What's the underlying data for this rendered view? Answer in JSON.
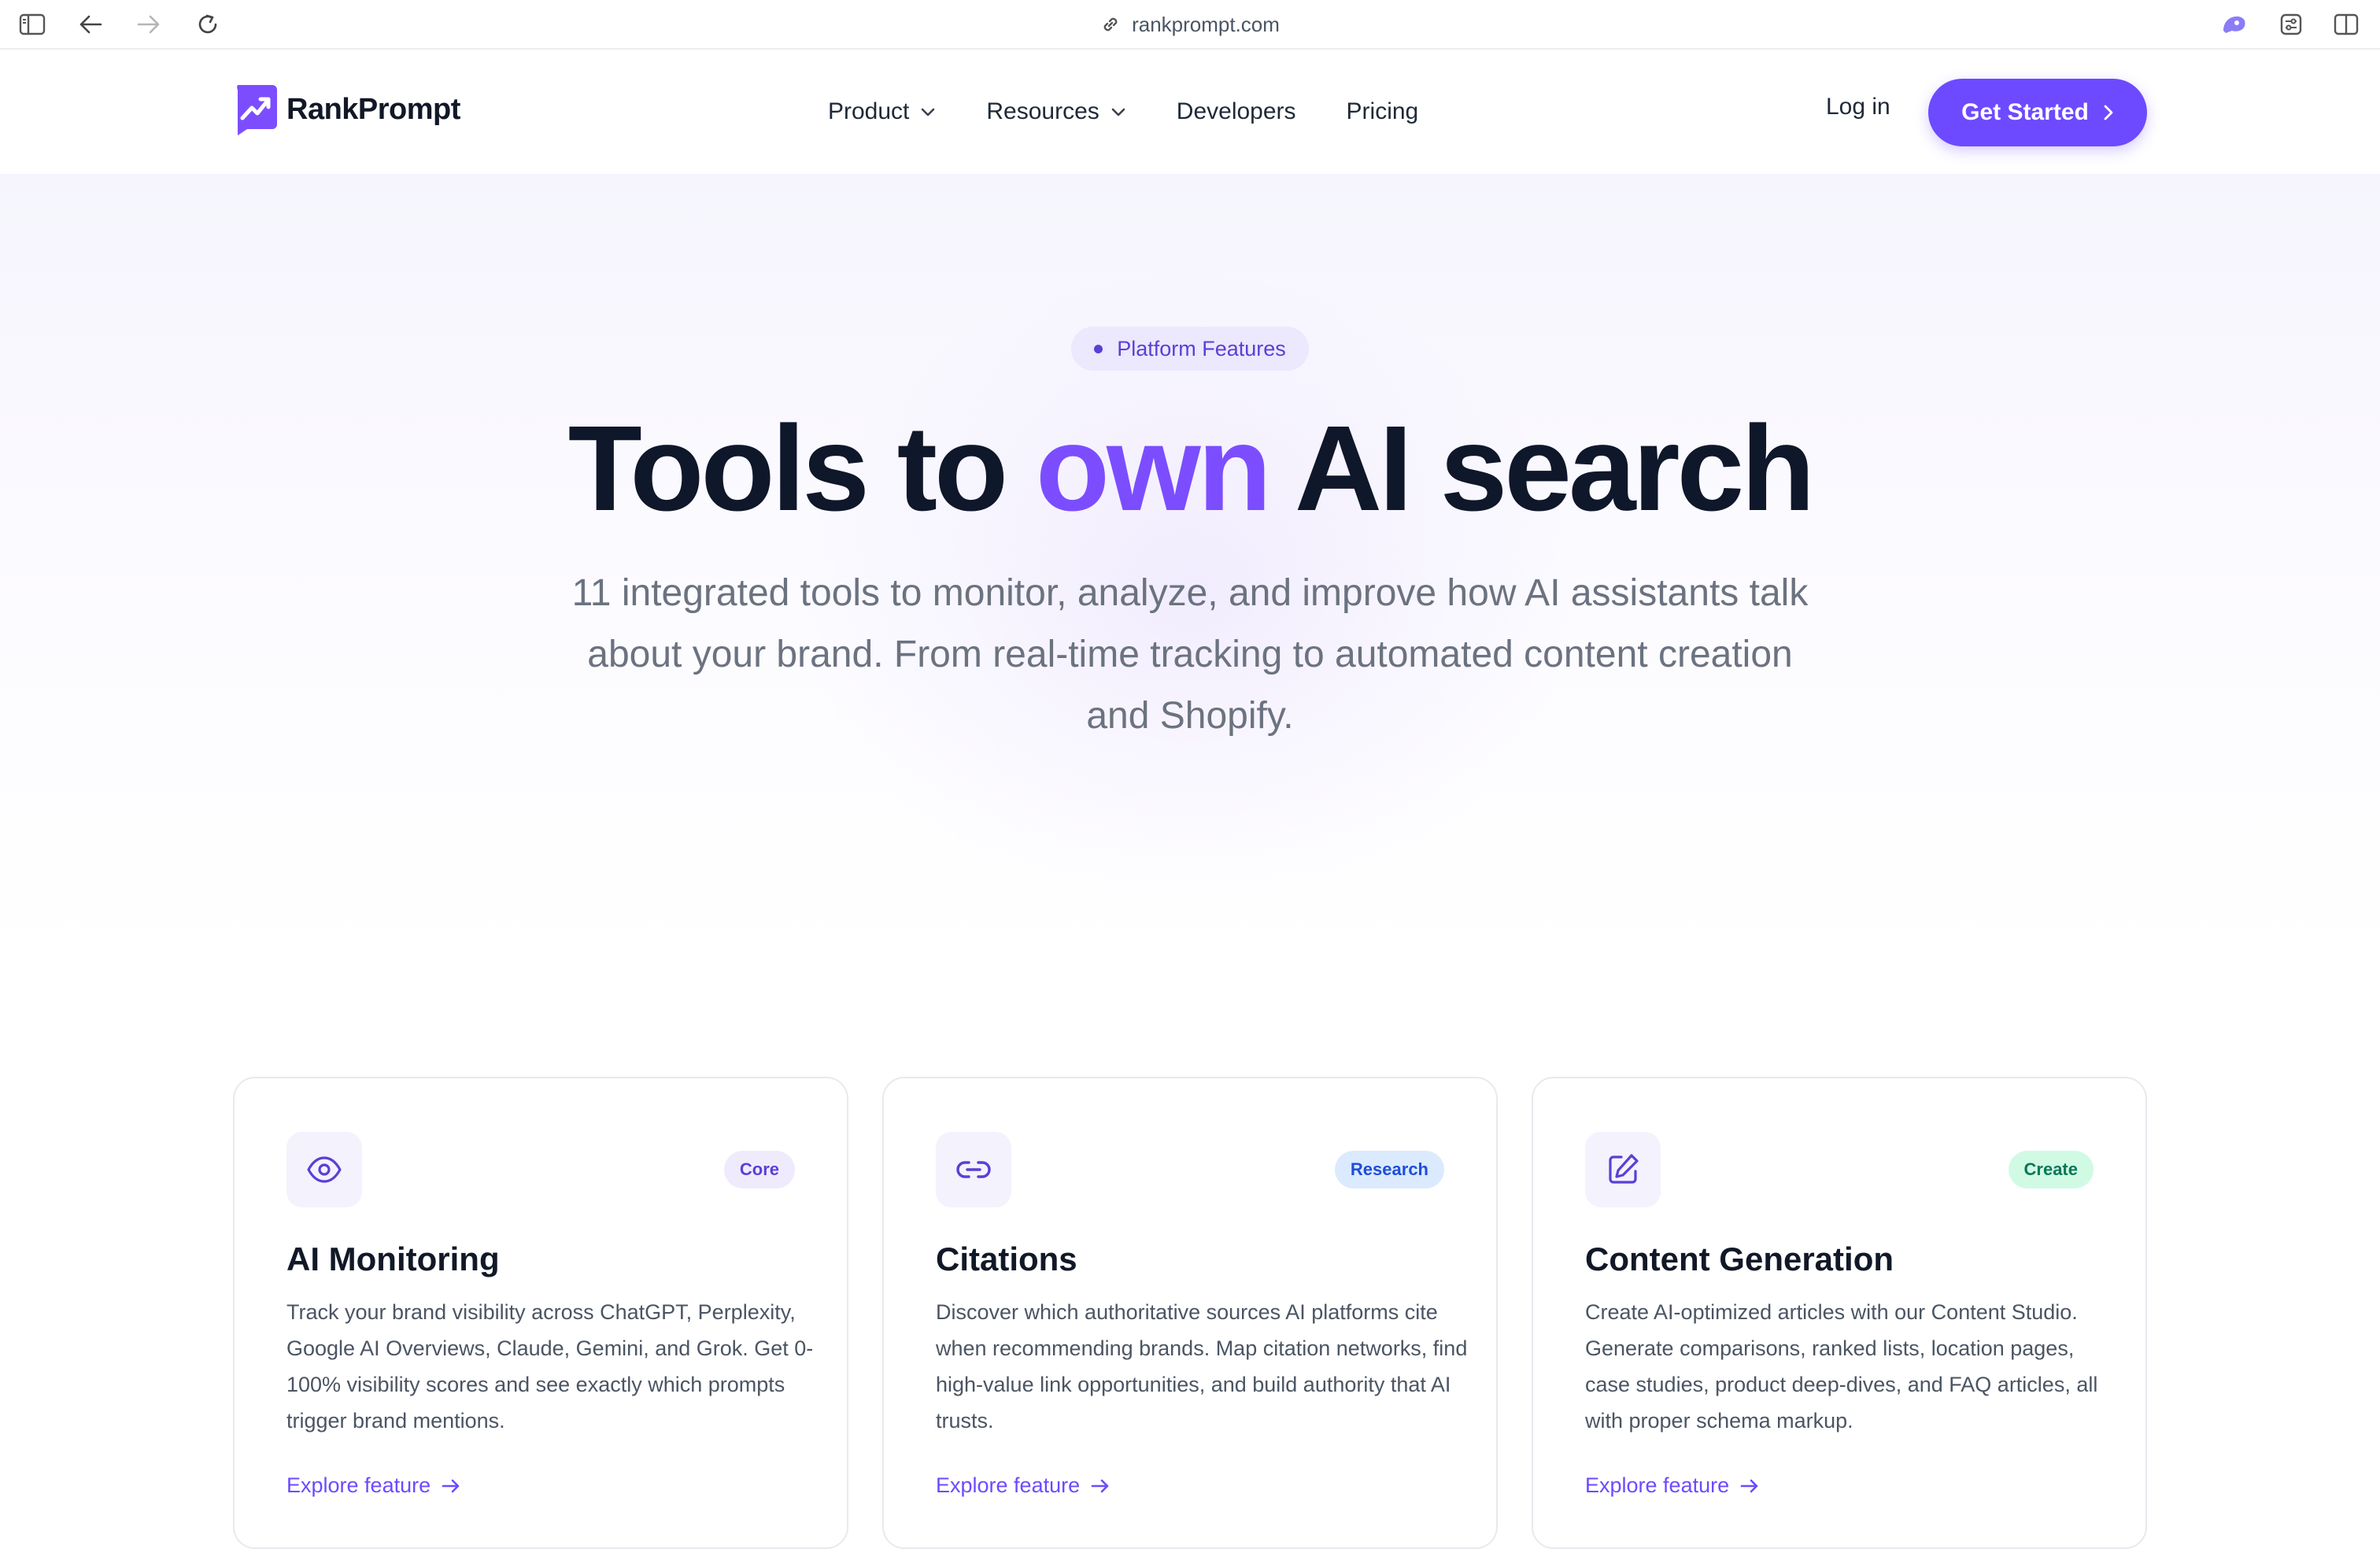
{
  "browser": {
    "url": "rankprompt.com"
  },
  "nav": {
    "brand": "RankPrompt",
    "menu": [
      {
        "label": "Product",
        "has_dropdown": true
      },
      {
        "label": "Resources",
        "has_dropdown": true
      },
      {
        "label": "Developers",
        "has_dropdown": false
      },
      {
        "label": "Pricing",
        "has_dropdown": false
      }
    ],
    "login": "Log in",
    "cta": "Get Started"
  },
  "hero": {
    "pill": "Platform Features",
    "headline_part1": "Tools to ",
    "headline_accent": "own",
    "headline_part2": " AI search",
    "subhead": "11 integrated tools to monitor, analyze, and improve how AI assistants talk about your brand. From real-time tracking to automated content creation and Shopify."
  },
  "cards": [
    {
      "icon": "eye-icon",
      "badge": "Core",
      "title": "AI Monitoring",
      "description": "Track your brand visibility across ChatGPT, Perplexity, Google AI Overviews, Claude, Gemini, and Grok. Get 0-100% visibility scores and see exactly which prompts trigger brand mentions.",
      "link": "Explore feature"
    },
    {
      "icon": "link-icon",
      "badge": "Research",
      "title": "Citations",
      "description": "Discover which authoritative sources AI platforms cite when recommending brands. Map citation networks, find high-value link opportunities, and build authority that AI trusts.",
      "link": "Explore feature"
    },
    {
      "icon": "edit-icon",
      "badge": "Create",
      "title": "Content Generation",
      "description": "Create AI-optimized articles with our Content Studio. Generate comparisons, ranked lists, location pages, case studies, product deep-dives, and FAQ articles, all with proper schema markup.",
      "link": "Explore feature"
    }
  ],
  "colors": {
    "brand": "#6d4aff",
    "accent_text": "#7c4dff",
    "core_badge": "#efebfd",
    "research_badge": "#dbeafe",
    "create_badge": "#d1fae5"
  }
}
